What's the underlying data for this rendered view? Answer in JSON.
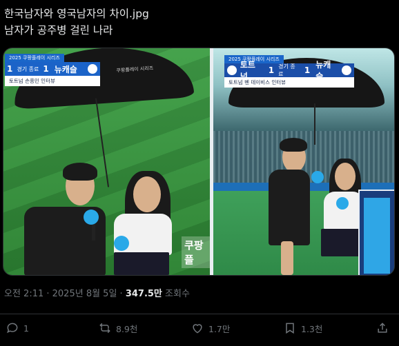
{
  "tweet": {
    "line1": "한국남자와 영국남자의 차이.jpg",
    "line2": "남자가 공주병 걸린 나라"
  },
  "media": {
    "left": {
      "series": "2025 쿠팡플레이 시리즈",
      "team_left_score": "1",
      "status": "경기 종료",
      "team_right_score": "1",
      "team_right": "뉴캐슬",
      "subtitle": "토트넘 손흥민 인터뷰",
      "umbrella_text": "쿠팡플레이 시리즈"
    },
    "right": {
      "series": "2025 쿠팡플레이 시리즈",
      "team_left": "토트넘",
      "team_left_score": "1",
      "status": "경기 종료",
      "team_right_score": "1",
      "team_right": "뉴캐슬",
      "subtitle": "토트넘 벤 데이비스 인터뷰"
    },
    "sign_text": "쿠팡플"
  },
  "meta": {
    "time_date": "오전 2:11 · 2025년 8월 5일 · ",
    "views": "347.5만",
    "views_label": " 조회수"
  },
  "actions": {
    "replies": "1",
    "retweets": "8.9천",
    "likes": "1.7만",
    "bookmarks": "1.3천"
  },
  "icons": [
    "reply-icon",
    "retweet-icon",
    "like-icon",
    "bookmark-icon",
    "share-icon"
  ],
  "colors": {
    "background": "#000000",
    "text": "#e7e9ea",
    "muted": "#71767b",
    "scorebug": "#1b63c8"
  }
}
